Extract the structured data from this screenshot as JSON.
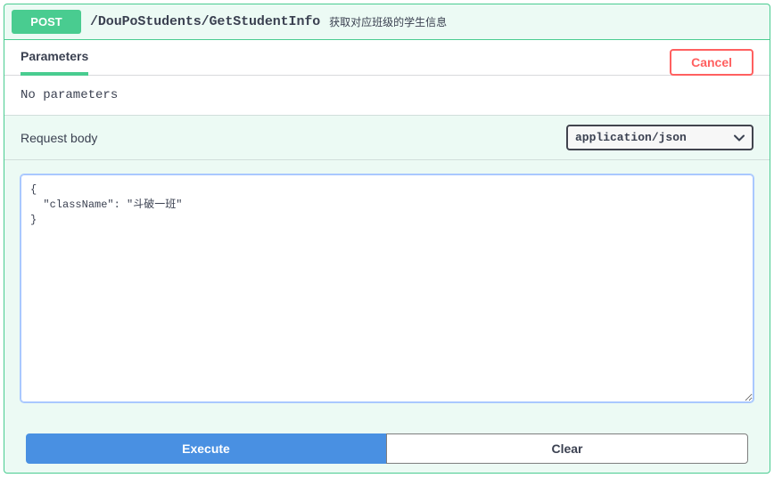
{
  "method": "POST",
  "path": "/DouPoStudents/GetStudentInfo",
  "summary": "获取对应班级的学生信息",
  "parameters_label": "Parameters",
  "cancel_label": "Cancel",
  "no_parameters_text": "No parameters",
  "request_body_label": "Request body",
  "content_type": {
    "selected": "application/json",
    "options": [
      "application/json"
    ]
  },
  "request_body_value": "{\n  \"className\": \"斗破一班\"\n}",
  "execute_label": "Execute",
  "clear_label": "Clear"
}
